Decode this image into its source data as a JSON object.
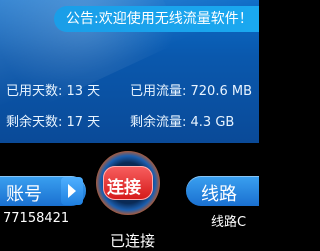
{
  "announcement": "公告:欢迎使用无线流量软件！",
  "stats": {
    "used_days": "已用天数: 13 天",
    "used_flow": "已用流量: 720.6 MB",
    "left_days": "剩余天数: 17 天",
    "left_flow": "剩余流量: 4.3 GB"
  },
  "account": {
    "label": "账号",
    "value": "77158421"
  },
  "connect": {
    "label": "连接",
    "status": "已连接"
  },
  "route": {
    "label": "线路",
    "value": "线路C"
  },
  "colors": {
    "accent": "#1a9ee8",
    "connect_red": "#d41818"
  }
}
